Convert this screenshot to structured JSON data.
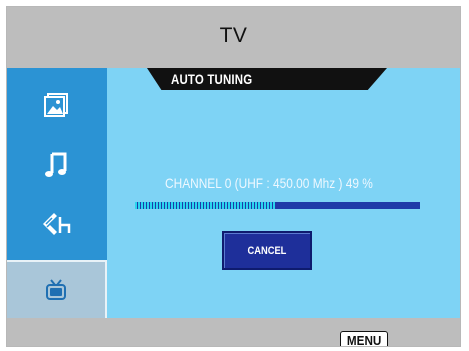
{
  "header": {
    "title": "TV"
  },
  "sidebar": {
    "items": [
      {
        "icon": "photo-icon",
        "active": false
      },
      {
        "icon": "music-note-icon",
        "active": false
      },
      {
        "icon": "movie-icon",
        "active": false
      },
      {
        "icon": "tv-icon",
        "active": true
      }
    ]
  },
  "dialog": {
    "title": "AUTO TUNING",
    "status": "CHANNEL 0 (UHF : 450.00 Mhz ) 49 %",
    "progress_percent": 49,
    "cancel_label": "CANCEL"
  },
  "footer": {
    "menu_label": "MENU"
  },
  "colors": {
    "sidebar": "#2b93d4",
    "content": "#7ed3f5",
    "progress_fill": "#2bd4ee",
    "progress_track": "#1f3aa8",
    "button": "#1e2f9a"
  }
}
